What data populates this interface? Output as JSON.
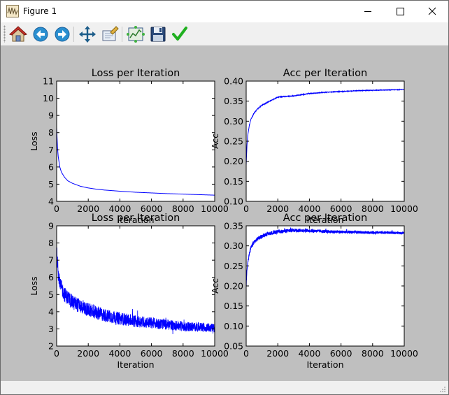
{
  "window": {
    "title": "Figure 1"
  },
  "toolbar": {
    "buttons": [
      {
        "icon": "home-icon"
      },
      {
        "icon": "back-icon"
      },
      {
        "icon": "forward-icon"
      },
      {
        "icon": "pan-icon"
      },
      {
        "icon": "zoom-icon"
      },
      {
        "icon": "configure-subplots-icon"
      },
      {
        "icon": "save-icon"
      },
      {
        "icon": "edit-checkmark-icon"
      }
    ]
  },
  "colors": {
    "figure_bg": "#bfbfbf",
    "axes_bg": "#ffffff",
    "line": "#0000ff"
  },
  "chart_data": [
    {
      "type": "line",
      "title": "Loss per Iteration",
      "xlabel": "Iteration",
      "ylabel": "Loss",
      "xlim": [
        0,
        10000
      ],
      "ylim": [
        4,
        11
      ],
      "xticks": [
        0,
        2000,
        4000,
        6000,
        8000,
        10000
      ],
      "yticks": [
        4,
        5,
        6,
        7,
        8,
        9,
        10,
        11
      ],
      "series": [
        {
          "x": [
            0,
            50,
            100,
            200,
            300,
            500,
            700,
            1000,
            1500,
            2000,
            2500,
            3000,
            4000,
            5000,
            6000,
            7000,
            8000,
            9000,
            10000
          ],
          "y": [
            8.3,
            7.2,
            6.6,
            6.0,
            5.7,
            5.4,
            5.2,
            5.05,
            4.88,
            4.78,
            4.71,
            4.66,
            4.59,
            4.53,
            4.49,
            4.45,
            4.42,
            4.39,
            4.36
          ],
          "noise": 0
        }
      ]
    },
    {
      "type": "line",
      "title": "Acc per Iteration",
      "xlabel": "Iteration",
      "ylabel": "Acc",
      "xlim": [
        0,
        10000
      ],
      "ylim": [
        0.1,
        0.4
      ],
      "xticks": [
        0,
        2000,
        4000,
        6000,
        8000,
        10000
      ],
      "yticks": [
        0.1,
        0.15,
        0.2,
        0.25,
        0.3,
        0.35,
        0.4
      ],
      "series": [
        {
          "x": [
            0,
            50,
            100,
            200,
            300,
            500,
            700,
            1000,
            1500,
            2000,
            2500,
            3000,
            4000,
            5000,
            6000,
            7000,
            8000,
            9000,
            10000
          ],
          "y": [
            0.19,
            0.24,
            0.265,
            0.29,
            0.305,
            0.32,
            0.33,
            0.34,
            0.35,
            0.36,
            0.362,
            0.363,
            0.369,
            0.372,
            0.374,
            0.376,
            0.377,
            0.378,
            0.379
          ],
          "noise": 0.0008
        }
      ]
    },
    {
      "type": "line",
      "title": "Loss per Iteration",
      "xlabel": "Iteration",
      "ylabel": "Loss",
      "xlim": [
        0,
        10000
      ],
      "ylim": [
        2,
        9
      ],
      "xticks": [
        0,
        2000,
        4000,
        6000,
        8000,
        10000
      ],
      "yticks": [
        2,
        3,
        4,
        5,
        6,
        7,
        8,
        9
      ],
      "series": [
        {
          "x": [
            0,
            100,
            300,
            500,
            1000,
            2000,
            3000,
            4000,
            5000,
            6000,
            7000,
            8000,
            9000,
            10000
          ],
          "y": [
            7.6,
            6.2,
            5.4,
            5.0,
            4.55,
            4.1,
            3.8,
            3.6,
            3.45,
            3.35,
            3.25,
            3.15,
            3.1,
            3.05
          ],
          "noise": 0.45
        }
      ]
    },
    {
      "type": "line",
      "title": "Acc per Iteration",
      "xlabel": "Iteration",
      "ylabel": "Acc",
      "xlim": [
        0,
        10000
      ],
      "ylim": [
        0.05,
        0.35
      ],
      "xticks": [
        0,
        2000,
        4000,
        6000,
        8000,
        10000
      ],
      "yticks": [
        0.05,
        0.1,
        0.15,
        0.2,
        0.25,
        0.3,
        0.35
      ],
      "series": [
        {
          "x": [
            0,
            50,
            100,
            200,
            300,
            500,
            800,
            1200,
            1800,
            2500,
            3000,
            4000,
            5000,
            6000,
            7000,
            8000,
            9000,
            10000
          ],
          "y": [
            0.2,
            0.24,
            0.26,
            0.28,
            0.295,
            0.31,
            0.32,
            0.328,
            0.334,
            0.337,
            0.339,
            0.338,
            0.336,
            0.335,
            0.334,
            0.333,
            0.333,
            0.332
          ],
          "noise": 0.005
        }
      ]
    }
  ]
}
